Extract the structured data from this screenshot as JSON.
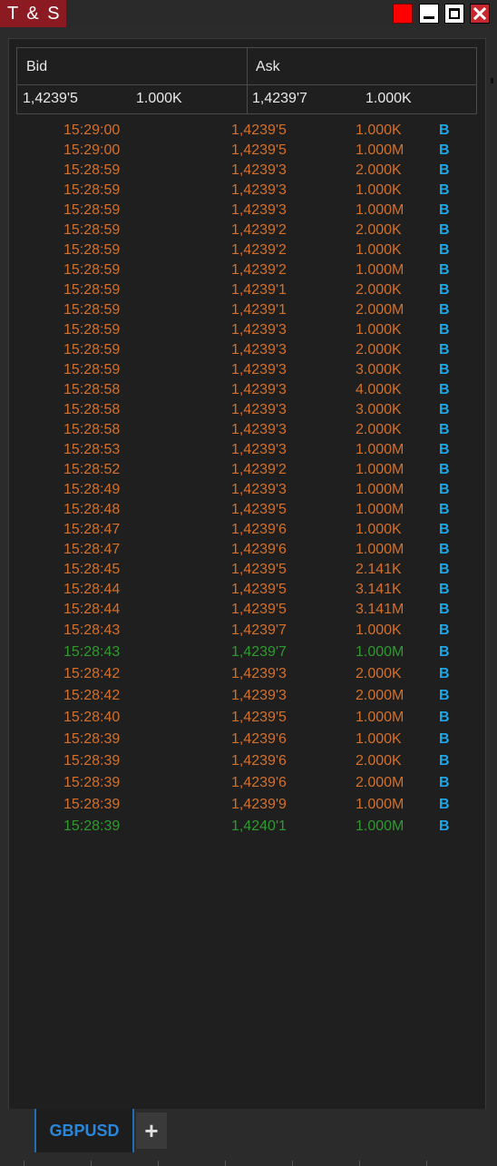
{
  "window": {
    "title": "T & S"
  },
  "quote": {
    "bid_label": "Bid",
    "ask_label": "Ask",
    "bid_price": "1,4239'5",
    "bid_size": "1.000K",
    "ask_price": "1,4239'7",
    "ask_size": "1.000K"
  },
  "colors": {
    "sell": "#d2702c",
    "buy": "#2f9a2f",
    "side": "#1ea7e6",
    "tab_accent": "#2a86d8"
  },
  "trades": [
    {
      "time": "15:29:00",
      "price": "1,4239'5",
      "size": "1.000K",
      "side": "B",
      "color": "orange"
    },
    {
      "time": "15:29:00",
      "price": "1,4239'5",
      "size": "1.000M",
      "side": "B",
      "color": "orange"
    },
    {
      "time": "15:28:59",
      "price": "1,4239'3",
      "size": "2.000K",
      "side": "B",
      "color": "orange"
    },
    {
      "time": "15:28:59",
      "price": "1,4239'3",
      "size": "1.000K",
      "side": "B",
      "color": "orange"
    },
    {
      "time": "15:28:59",
      "price": "1,4239'3",
      "size": "1.000M",
      "side": "B",
      "color": "orange"
    },
    {
      "time": "15:28:59",
      "price": "1,4239'2",
      "size": "2.000K",
      "side": "B",
      "color": "orange"
    },
    {
      "time": "15:28:59",
      "price": "1,4239'2",
      "size": "1.000K",
      "side": "B",
      "color": "orange"
    },
    {
      "time": "15:28:59",
      "price": "1,4239'2",
      "size": "1.000M",
      "side": "B",
      "color": "orange"
    },
    {
      "time": "15:28:59",
      "price": "1,4239'1",
      "size": "2.000K",
      "side": "B",
      "color": "orange"
    },
    {
      "time": "15:28:59",
      "price": "1,4239'1",
      "size": "2.000M",
      "side": "B",
      "color": "orange"
    },
    {
      "time": "15:28:59",
      "price": "1,4239'3",
      "size": "1.000K",
      "side": "B",
      "color": "orange"
    },
    {
      "time": "15:28:59",
      "price": "1,4239'3",
      "size": "2.000K",
      "side": "B",
      "color": "orange"
    },
    {
      "time": "15:28:59",
      "price": "1,4239'3",
      "size": "3.000K",
      "side": "B",
      "color": "orange"
    },
    {
      "time": "15:28:58",
      "price": "1,4239'3",
      "size": "4.000K",
      "side": "B",
      "color": "orange"
    },
    {
      "time": "15:28:58",
      "price": "1,4239'3",
      "size": "3.000K",
      "side": "B",
      "color": "orange"
    },
    {
      "time": "15:28:58",
      "price": "1,4239'3",
      "size": "2.000K",
      "side": "B",
      "color": "orange"
    },
    {
      "time": "15:28:53",
      "price": "1,4239'3",
      "size": "1.000M",
      "side": "B",
      "color": "orange"
    },
    {
      "time": "15:28:52",
      "price": "1,4239'2",
      "size": "1.000M",
      "side": "B",
      "color": "orange"
    },
    {
      "time": "15:28:49",
      "price": "1,4239'3",
      "size": "1.000M",
      "side": "B",
      "color": "orange"
    },
    {
      "time": "15:28:48",
      "price": "1,4239'5",
      "size": "1.000M",
      "side": "B",
      "color": "orange"
    },
    {
      "time": "15:28:47",
      "price": "1,4239'6",
      "size": "1.000K",
      "side": "B",
      "color": "orange"
    },
    {
      "time": "15:28:47",
      "price": "1,4239'6",
      "size": "1.000M",
      "side": "B",
      "color": "orange"
    },
    {
      "time": "15:28:45",
      "price": "1,4239'5",
      "size": "2.141K",
      "side": "B",
      "color": "orange"
    },
    {
      "time": "15:28:44",
      "price": "1,4239'5",
      "size": "3.141K",
      "side": "B",
      "color": "orange"
    },
    {
      "time": "15:28:44",
      "price": "1,4239'5",
      "size": "3.141M",
      "side": "B",
      "color": "orange"
    },
    {
      "time": "15:28:43",
      "price": "1,4239'7",
      "size": "1.000K",
      "side": "B",
      "color": "orange"
    },
    {
      "time": "15:28:43",
      "price": "1,4239'7",
      "size": "1.000M",
      "side": "B",
      "color": "green"
    },
    {
      "time": "15:28:42",
      "price": "1,4239'3",
      "size": "2.000K",
      "side": "B",
      "color": "orange"
    },
    {
      "time": "15:28:42",
      "price": "1,4239'3",
      "size": "2.000M",
      "side": "B",
      "color": "orange"
    },
    {
      "time": "15:28:40",
      "price": "1,4239'5",
      "size": "1.000M",
      "side": "B",
      "color": "orange"
    },
    {
      "time": "15:28:39",
      "price": "1,4239'6",
      "size": "1.000K",
      "side": "B",
      "color": "orange"
    },
    {
      "time": "15:28:39",
      "price": "1,4239'6",
      "size": "2.000K",
      "side": "B",
      "color": "orange"
    },
    {
      "time": "15:28:39",
      "price": "1,4239'6",
      "size": "2.000M",
      "side": "B",
      "color": "orange"
    },
    {
      "time": "15:28:39",
      "price": "1,4239'9",
      "size": "1.000M",
      "side": "B",
      "color": "orange"
    },
    {
      "time": "15:28:39",
      "price": "1,4240'1",
      "size": "1.000M",
      "side": "B",
      "color": "green"
    }
  ],
  "tabs": {
    "active": "GBPUSD",
    "add_label": "+"
  }
}
